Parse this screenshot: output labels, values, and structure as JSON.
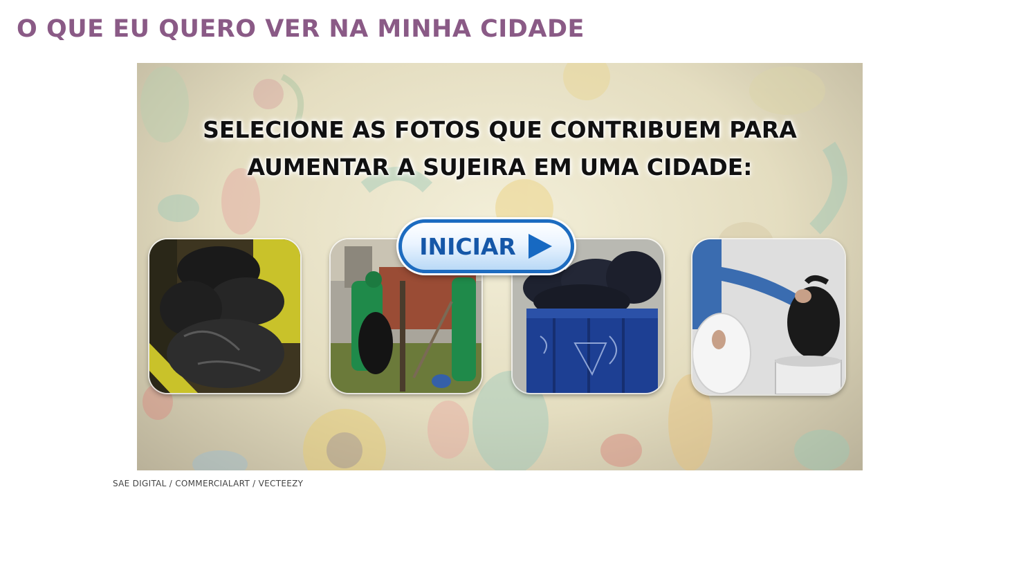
{
  "page": {
    "title": "O QUE EU QUERO VER NA MINHA CIDADE"
  },
  "activity": {
    "prompt_line1": "SELECIONE AS FOTOS QUE CONTRIBUEM PARA",
    "prompt_line2": "AUMENTAR A SUJEIRA EM UMA CIDADE:",
    "start_button": {
      "label": "INICIAR",
      "icon": "play-arrow-icon"
    },
    "photos": [
      {
        "subject": "trash-bags-on-floor"
      },
      {
        "subject": "street-sweepers"
      },
      {
        "subject": "overflowing-dumpster"
      },
      {
        "subject": "bag-into-bin"
      }
    ],
    "colors": {
      "button_blue": "#1d6cc0",
      "title_purple": "#8a5a86"
    }
  },
  "credit": {
    "text": "SAE DIGITAL / COMMERCIALART / VECTEEZY"
  }
}
